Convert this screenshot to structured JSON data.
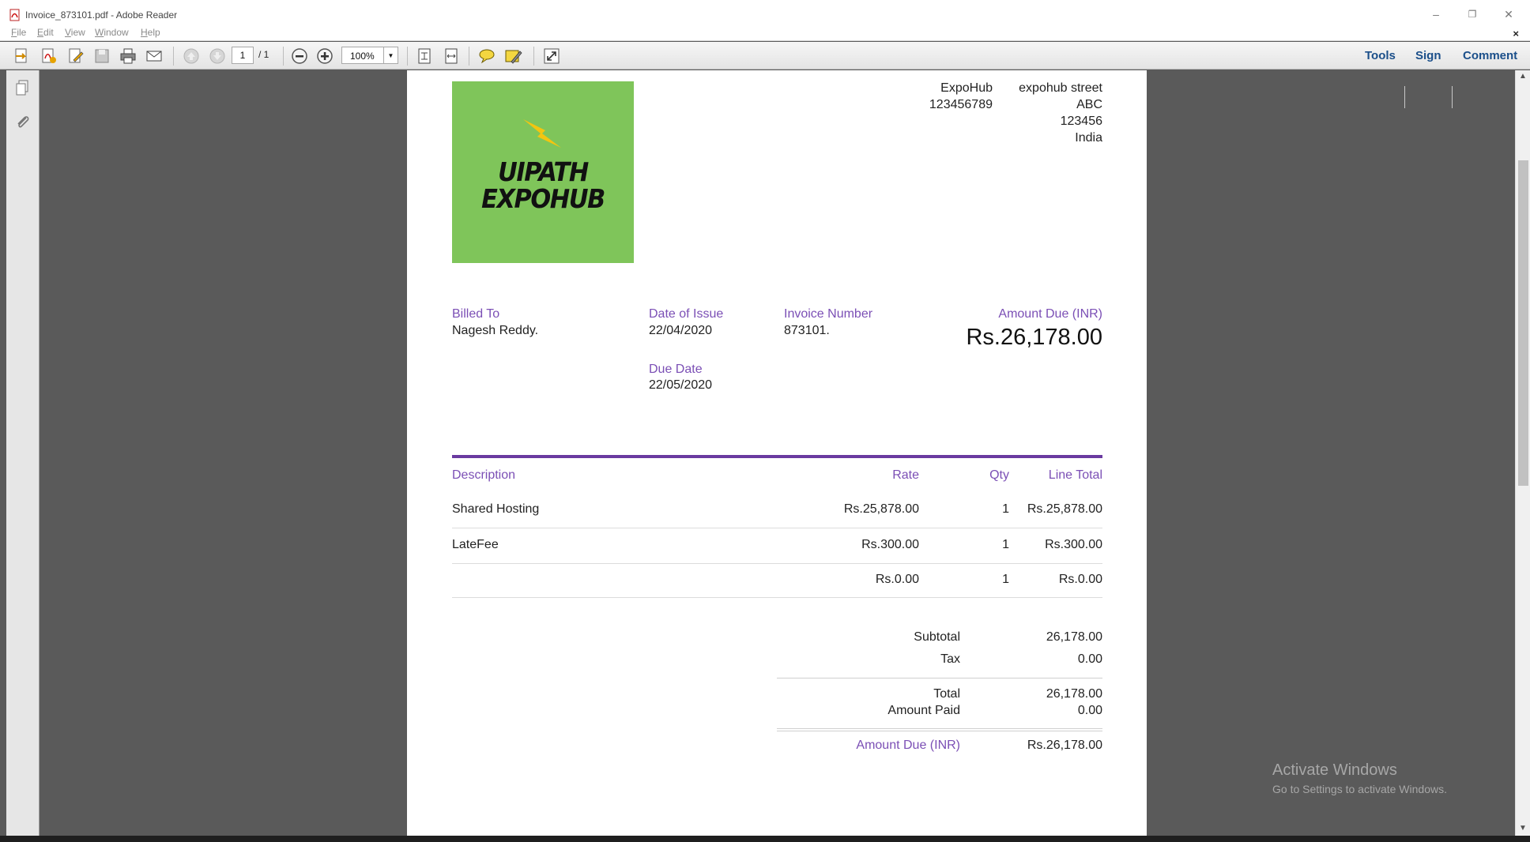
{
  "window": {
    "title": "Invoice_873101.pdf - Adobe Reader",
    "minimize_glyph": "–",
    "restore_glyph": "❐",
    "close_glyph": "✕",
    "doc_close_glyph": "×"
  },
  "menubar": {
    "items": [
      {
        "first": "F",
        "rest": "ile"
      },
      {
        "first": "E",
        "rest": "dit"
      },
      {
        "first": "V",
        "rest": "iew"
      },
      {
        "first": "W",
        "rest": "indow"
      },
      {
        "first": "H",
        "rest": "elp"
      }
    ]
  },
  "toolbar": {
    "current_page": "1",
    "total_pages": "/ 1",
    "zoom": "100%",
    "tools_label": "Tools",
    "sign_label": "Sign",
    "comment_label": "Comment"
  },
  "invoice": {
    "logo_lines": [
      "UIPATH",
      "EXPOHUB"
    ],
    "company_name": "ExpoHub",
    "company_phone": "123456789",
    "address": [
      "expohub street",
      "ABC",
      "123456",
      "India"
    ],
    "billed_to_label": "Billed To",
    "billed_to": "Nagesh Reddy.",
    "date_issue_label": "Date of Issue",
    "date_issue": "22/04/2020",
    "due_date_label": "Due Date",
    "due_date": "22/05/2020",
    "invoice_number_label": "Invoice Number",
    "invoice_number": "873101.",
    "amount_due_label": "Amount Due (INR)",
    "amount_due_big": "Rs.26,178.00",
    "columns": {
      "description": "Description",
      "rate": "Rate",
      "qty": "Qty",
      "line_total": "Line Total"
    },
    "rows": [
      {
        "description": "Shared Hosting",
        "rate": "Rs.25,878.00",
        "qty": "1",
        "line_total": "Rs.25,878.00"
      },
      {
        "description": "LateFee",
        "rate": "Rs.300.00",
        "qty": "1",
        "line_total": "Rs.300.00"
      },
      {
        "description": "",
        "rate": "Rs.0.00",
        "qty": "1",
        "line_total": "Rs.0.00"
      }
    ],
    "subtotal_label": "Subtotal",
    "subtotal": "26,178.00",
    "tax_label": "Tax",
    "tax": "0.00",
    "total_label": "Total",
    "total": "26,178.00",
    "amount_paid_label": "Amount Paid",
    "amount_paid": "0.00",
    "amount_due_footer_label": "Amount Due (INR)",
    "amount_due_footer": "Rs.26,178.00"
  },
  "watermark": {
    "title": "Activate Windows",
    "subtitle": "Go to Settings to activate Windows."
  },
  "colors": {
    "accent_purple": "#7b4fb5",
    "logo_green": "#7fc55a",
    "link_blue": "#1b4f8a"
  }
}
